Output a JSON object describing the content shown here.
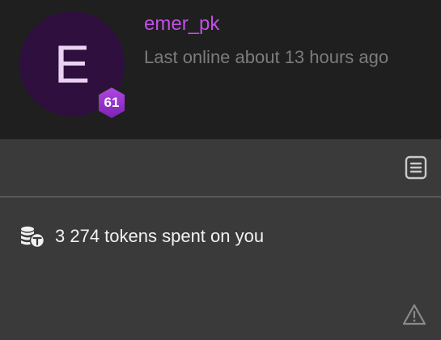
{
  "profile": {
    "avatar_letter": "E",
    "level": "61",
    "username": "emer_pk",
    "last_online": "Last online about 13 hours ago"
  },
  "stats": {
    "tokens_text": "3 274 tokens spent on you"
  },
  "icons": {
    "document": "document-icon",
    "coins": "coins-icon",
    "warning": "warning-icon",
    "level_badge": "hexagon-badge"
  },
  "colors": {
    "username": "#c44ee8",
    "avatar_bg": "#2e0f3d",
    "badge": "#9b2fc9",
    "header_bg": "#1f1f1f",
    "body_bg": "#3a3a3a"
  }
}
